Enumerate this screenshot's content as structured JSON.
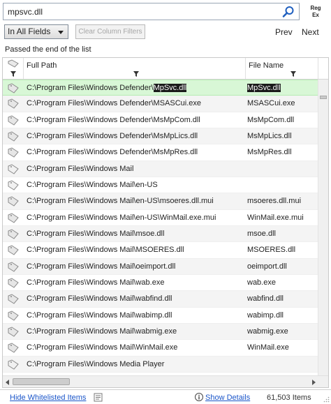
{
  "search": {
    "value": "mpsvc.dll"
  },
  "toolbar": {
    "regex_label": [
      "Reg",
      "Ex"
    ],
    "field_select": "In All Fields",
    "clear_filters": "Clear Column Filters",
    "prev": "Prev",
    "next": "Next"
  },
  "status_text": "Passed the end of the list",
  "columns": {
    "full_path": "Full Path",
    "file_name": "File Name"
  },
  "rows": [
    {
      "path_prefix": "C:\\Program Files\\Windows Defender\\",
      "path_match": "MpSvc.dll",
      "file_match": "MpSvc.dll",
      "selected": true,
      "icon": "document-icon"
    },
    {
      "path": "C:\\Program Files\\Windows Defender\\MSASCui.exe",
      "file": "MSASCui.exe",
      "icon": "document-icon"
    },
    {
      "path": "C:\\Program Files\\Windows Defender\\MsMpCom.dll",
      "file": "MsMpCom.dll",
      "icon": "document-icon"
    },
    {
      "path": "C:\\Program Files\\Windows Defender\\MsMpLics.dll",
      "file": "MsMpLics.dll",
      "icon": "document-icon"
    },
    {
      "path": "C:\\Program Files\\Windows Defender\\MsMpRes.dll",
      "file": "MsMpRes.dll",
      "icon": "document-icon"
    },
    {
      "path": "C:\\Program Files\\Windows Mail",
      "file": "",
      "icon": "folder-icon"
    },
    {
      "path": "C:\\Program Files\\Windows Mail\\en-US",
      "file": "",
      "icon": "folder-icon"
    },
    {
      "path": "C:\\Program Files\\Windows Mail\\en-US\\msoeres.dll.mui",
      "file": "msoeres.dll.mui",
      "icon": "document-icon"
    },
    {
      "path": "C:\\Program Files\\Windows Mail\\en-US\\WinMail.exe.mui",
      "file": "WinMail.exe.mui",
      "icon": "document-icon"
    },
    {
      "path": "C:\\Program Files\\Windows Mail\\msoe.dll",
      "file": "msoe.dll",
      "icon": "document-icon"
    },
    {
      "path": "C:\\Program Files\\Windows Mail\\MSOERES.dll",
      "file": "MSOERES.dll",
      "icon": "document-icon"
    },
    {
      "path": "C:\\Program Files\\Windows Mail\\oeimport.dll",
      "file": "oeimport.dll",
      "icon": "document-icon"
    },
    {
      "path": "C:\\Program Files\\Windows Mail\\wab.exe",
      "file": "wab.exe",
      "icon": "document-icon"
    },
    {
      "path": "C:\\Program Files\\Windows Mail\\wabfind.dll",
      "file": "wabfind.dll",
      "icon": "document-icon"
    },
    {
      "path": "C:\\Program Files\\Windows Mail\\wabimp.dll",
      "file": "wabimp.dll",
      "icon": "document-icon"
    },
    {
      "path": "C:\\Program Files\\Windows Mail\\wabmig.exe",
      "file": "wabmig.exe",
      "icon": "document-icon"
    },
    {
      "path": "C:\\Program Files\\Windows Mail\\WinMail.exe",
      "file": "WinMail.exe",
      "icon": "document-icon"
    },
    {
      "path": "C:\\Program Files\\Windows Media Player",
      "file": "",
      "icon": "folder-icon"
    }
  ],
  "footer": {
    "hide_whitelisted": "Hide Whitelisted Items",
    "show_details": "Show Details",
    "item_count": "61,503 Items"
  },
  "colors": {
    "selected_row": "#d8f7d6",
    "link": "#1a55c9",
    "match_highlight": "#1a1a1a"
  }
}
